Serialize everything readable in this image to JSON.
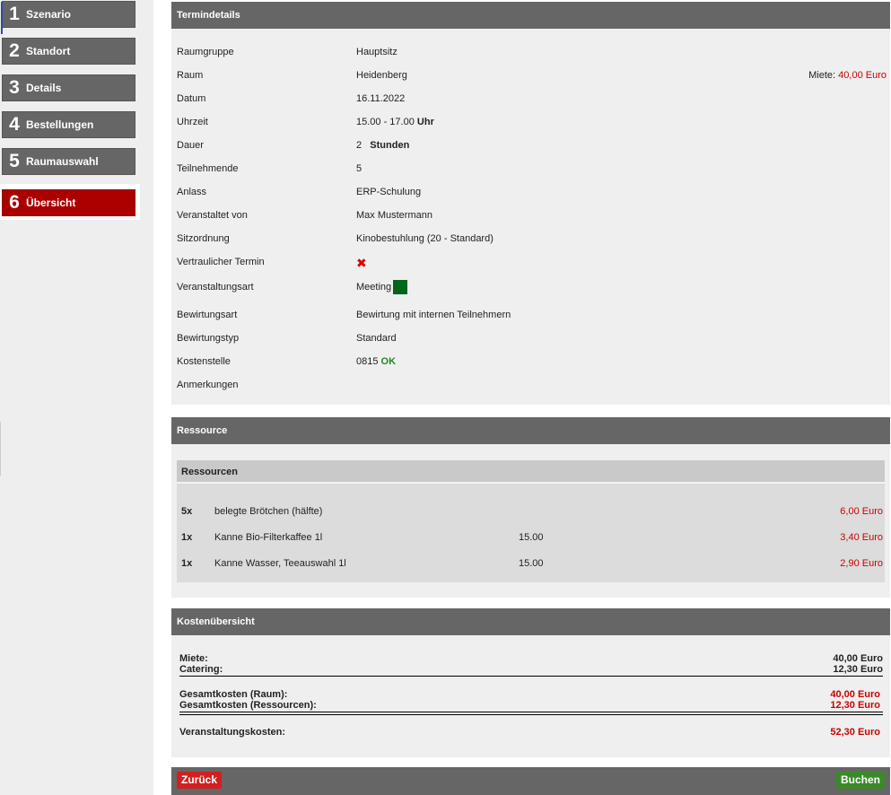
{
  "steps": [
    {
      "num": "1",
      "label": "Szenario"
    },
    {
      "num": "2",
      "label": "Standort"
    },
    {
      "num": "3",
      "label": "Details"
    },
    {
      "num": "4",
      "label": "Bestellungen"
    },
    {
      "num": "5",
      "label": "Raumauswahl"
    },
    {
      "num": "6",
      "label": "Übersicht"
    }
  ],
  "termin": {
    "title": "Termindetails",
    "raumgruppe": {
      "label": "Raumgruppe",
      "value": "Hauptsitz"
    },
    "raum": {
      "label": "Raum",
      "value": "Heidenberg",
      "miete_label": "Miete:",
      "miete_value": "40,00 Euro"
    },
    "datum": {
      "label": "Datum",
      "value": "16.11.2022"
    },
    "uhrzeit": {
      "label": "Uhrzeit",
      "value": "15.00 - 17.00",
      "unit": "Uhr"
    },
    "dauer": {
      "label": "Dauer",
      "value": "2",
      "unit": "Stunden"
    },
    "teilnehmende": {
      "label": "Teilnehmende",
      "value": "5"
    },
    "anlass": {
      "label": "Anlass",
      "value": "ERP-Schulung"
    },
    "veranstaltet": {
      "label": "Veranstaltet von",
      "value": "Max Mustermann"
    },
    "sitzordnung": {
      "label": "Sitzordnung",
      "value": "Kinobestuhlung (20 - Standard)"
    },
    "vertraulich": {
      "label": "Vertraulicher Termin",
      "icon": "cross-icon"
    },
    "veranstaltungsart": {
      "label": "Veranstaltungsart",
      "value": "Meeting",
      "color": "#00661a"
    },
    "bewirtungsart": {
      "label": "Bewirtungsart",
      "value": "Bewirtung mit internen Teilnehmern"
    },
    "bewirtungstyp": {
      "label": "Bewirtungstyp",
      "value": "Standard"
    },
    "kostenstelle": {
      "label": "Kostenstelle",
      "value": "0815",
      "status": "OK"
    },
    "anmerkungen": {
      "label": "Anmerkungen"
    }
  },
  "ressource": {
    "title": "Ressource",
    "box_title": "Ressourcen",
    "items": [
      {
        "qty": "5x",
        "name": "belegte Brötchen (hälfte)",
        "time": "",
        "price": "6,00 Euro"
      },
      {
        "qty": "1x",
        "name": "Kanne Bio-Filterkaffee 1l",
        "time": "15.00",
        "price": "3,40 Euro"
      },
      {
        "qty": "1x",
        "name": "Kanne Wasser, Teeauswahl 1l",
        "time": "15.00",
        "price": "2,90 Euro"
      }
    ]
  },
  "kosten": {
    "title": "Kostenübersicht",
    "miete": {
      "label": "Miete:",
      "value": "40,00 Euro"
    },
    "catering": {
      "label": "Catering:",
      "value": "12,30 Euro"
    },
    "gesamt_raum": {
      "label": "Gesamtkosten (Raum):",
      "value": "40,00 Euro"
    },
    "gesamt_res": {
      "label": "Gesamtkosten (Ressourcen):",
      "value": "12,30 Euro"
    },
    "veranstaltung": {
      "label": "Veranstaltungskosten:",
      "value": "52,30 Euro"
    }
  },
  "buttons": {
    "back": "Zurück",
    "book": "Buchen"
  },
  "colors": {
    "accent_active": "#aa0000",
    "step_bg": "#666666",
    "price_red": "#cc0000",
    "ok_green": "#228822",
    "book_green": "#3a8a2a",
    "back_red": "#d02020"
  }
}
